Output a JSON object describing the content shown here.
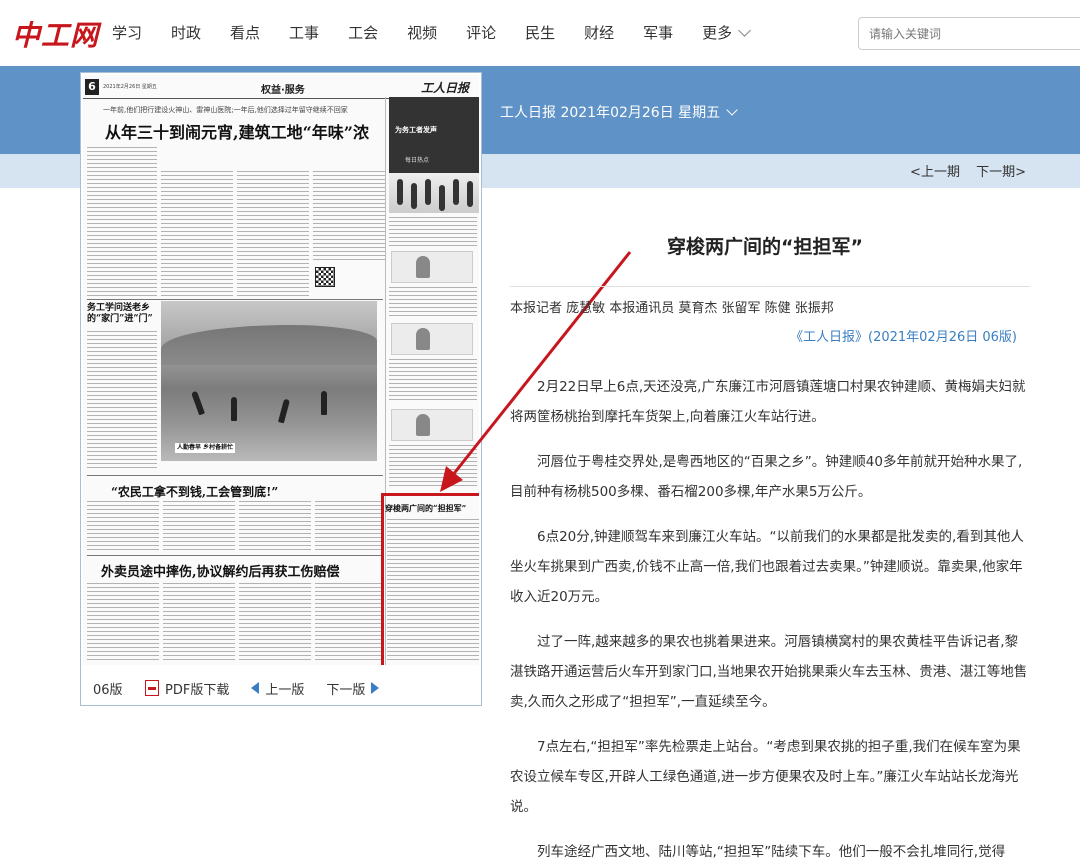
{
  "site": {
    "logo": "中工网"
  },
  "nav": {
    "items": [
      "学习",
      "时政",
      "看点",
      "工事",
      "工会",
      "视频",
      "评论",
      "民生",
      "财经",
      "军事"
    ],
    "more": "更多"
  },
  "search": {
    "placeholder": "请输入关键词"
  },
  "issue": {
    "date_label": "工人日报 2021年02月26日 星期五",
    "prev": "<上一期",
    "next": "下一期>"
  },
  "paper": {
    "page_num": "6",
    "page_date": "2021年2月26日 星期五",
    "section": "权益·服务",
    "masthead": "工人日报",
    "subheadline": "一年前,他们把行建设火神山、雷神山医院;一年后,他们选择过年留守继续不回家",
    "headline": "从年三十到闹元宵,建筑工地“年味”浓",
    "headline2": "务工学问送老乡的“家门”进“门”",
    "photo_caption": "人勤春早 乡村备耕忙",
    "headline3": "“农民工拿不到钱,工会管到底!”",
    "headline4": "外卖员途中摔伤,协议解约后再获工伤赔偿",
    "side_title": "为务工者发声",
    "side_label": "每日热点",
    "highlight_title": "穿梭两广间的“担担军”",
    "bar": {
      "page_no": "06版",
      "pdf": "PDF版下载",
      "prev": "上一版",
      "next": "下一版"
    }
  },
  "article": {
    "title": "穿梭两广间的“担担军”",
    "byline": "本报记者 庞慧敏 本报通讯员 莫育杰 张留军 陈健 张振邦",
    "source": "《工人日报》(2021年02月26日 06版)",
    "paragraphs": [
      "2月22日早上6点,天还没亮,广东廉江市河唇镇莲塘口村果农钟建顺、黄梅娟夫妇就将两筐杨桃抬到摩托车货架上,向着廉江火车站行进。",
      "河唇位于粤桂交界处,是粤西地区的“百果之乡”。钟建顺40多年前就开始种水果了,目前种有杨桃500多棵、番石榴200多棵,年产水果5万公斤。",
      "6点20分,钟建顺驾车来到廉江火车站。“以前我们的水果都是批发卖的,看到其他人坐火车挑果到广西卖,价钱不止高一倍,我们也跟着过去卖果。”钟建顺说。靠卖果,他家年收入近20万元。",
      "过了一阵,越来越多的果农也挑着果进来。河唇镇横窝村的果农黄桂平告诉记者,黎湛铁路开通运营后火车开到家门口,当地果农开始挑果乘火车去玉林、贵港、湛江等地售卖,久而久之形成了“担担军”,一直延续至今。",
      "7点左右,“担担军”率先检票走上站台。“考虑到果农挑的担子重,我们在候车室为果农设立候车专区,开辟人工绿色通道,进一步方便果农及时上车。”廉江火车站站长龙海光说。",
      "列车途经广西文地、陆川等站,“担担军”陆续下车。他们一般不会扎堆同行,觉得"
    ]
  },
  "colors": {
    "brand_red": "#c8161d",
    "band_blue": "#5f92c6",
    "band_light": "#d6e4f2",
    "link_blue": "#3a7ec2"
  }
}
